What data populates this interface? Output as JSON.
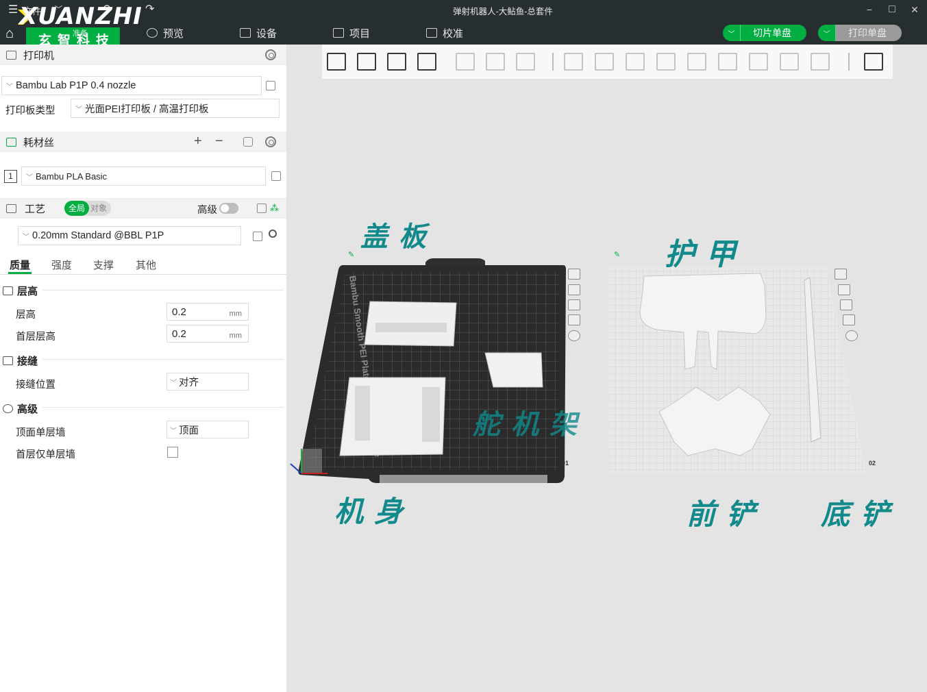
{
  "titlebar": {
    "menu_label": "文件",
    "document_title": "弹射机器人-大鲇鱼-总套件",
    "minimize": "−",
    "maximize": "□",
    "close": "✕"
  },
  "logo": {
    "wordmark": "XUANZHI",
    "subtitle": "玄智科技",
    "partial_label": "准备"
  },
  "nav": {
    "preview": "预览",
    "device": "设备",
    "project": "项目",
    "calibration": "校准"
  },
  "actions": {
    "slice_label": "切片单盘",
    "print_label": "打印单盘"
  },
  "colors": {
    "accent": "#00ae42",
    "dark_bar": "#262e30",
    "annotation": "#128a8c"
  },
  "printer": {
    "section_title": "打印机",
    "printer_name": "Bambu Lab P1P 0.4 nozzle",
    "plate_type_label": "打印板类型",
    "plate_type_value": "光面PEI打印板 / 高温打印板"
  },
  "filament": {
    "section_title": "耗材丝",
    "add": "+",
    "remove": "−",
    "slot_number": "1",
    "material": "Bambu PLA Basic"
  },
  "process": {
    "section_title": "工艺",
    "toggle_global": "全局",
    "toggle_object": "对象",
    "advanced_label": "高级",
    "preset": "0.20mm Standard @BBL P1P",
    "tabs": [
      "质量",
      "强度",
      "支撑",
      "其他"
    ]
  },
  "groups": {
    "layer_height": {
      "title": "层高",
      "layer_height_label": "层高",
      "layer_height_value": "0.2",
      "first_layer_label": "首层层高",
      "first_layer_value": "0.2",
      "unit": "mm"
    },
    "seam": {
      "title": "接缝",
      "seam_position_label": "接缝位置",
      "seam_position_value": "对齐"
    },
    "advanced": {
      "title": "高级",
      "top_single_wall_label": "顶面单层墙",
      "top_single_wall_value": "顶面",
      "first_layer_single_wall_label": "首层仅单层墙"
    }
  },
  "plates": {
    "plate1_text": "Bambu Smooth PEI Plate / High Temp Plate",
    "plate1_number": "01",
    "plate2_number": "02"
  },
  "annotations": {
    "cover": "盖板",
    "armor": "护甲",
    "servo_mount": "舵机架",
    "body": "机身",
    "front_shovel": "前铲",
    "bottom_shovel": "底铲"
  },
  "toolbar_icons": [
    "add-cube-icon",
    "arrange-grid-icon",
    "auto-orient-icon",
    "split-plate-icon",
    "box-0-icon",
    "box-p-icon",
    "layers-icon",
    "move-icon",
    "rotate-icon",
    "scale-icon",
    "lay-on-face-icon",
    "cut-icon",
    "boolean-icon",
    "support-paint-icon",
    "seam-paint-icon",
    "text-icon",
    "assembly-icon"
  ]
}
